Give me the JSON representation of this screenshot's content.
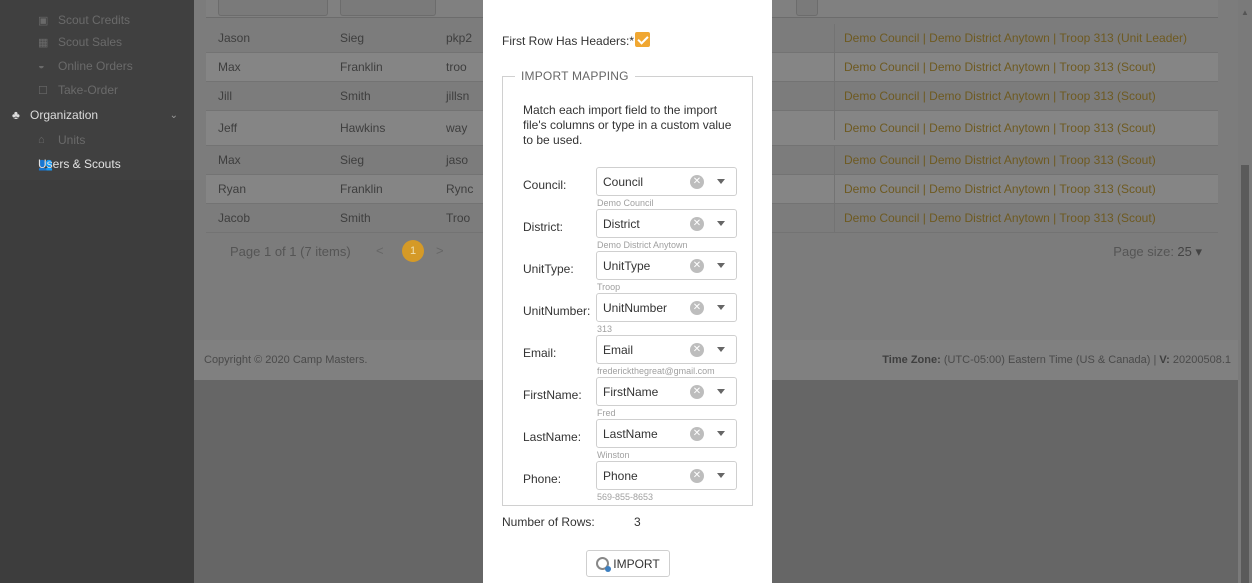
{
  "sidebar": {
    "items": [
      {
        "label": "Scout Credits",
        "icon": "credit-icon",
        "glyph": "▣"
      },
      {
        "label": "Scout Sales",
        "icon": "sales-icon",
        "glyph": "▦"
      },
      {
        "label": "Online Orders",
        "icon": "orders-icon",
        "glyph": "◒"
      },
      {
        "label": "Take-Order",
        "icon": "take-order-icon",
        "glyph": "☐"
      },
      {
        "label": "Organization",
        "icon": "sitemap-icon",
        "glyph": "♣",
        "chevron": "⌄"
      },
      {
        "label": "Units",
        "icon": "home-icon",
        "glyph": "⌂"
      },
      {
        "label": "Users & Scouts",
        "icon": "users-icon",
        "glyph": "👥"
      }
    ]
  },
  "table": {
    "rows": [
      {
        "first": "Jason",
        "last": "Sieg",
        "user": "pkp2",
        "org": "Demo Council | Demo District Anytown | Troop 313 (Unit Leader)"
      },
      {
        "first": "Max",
        "last": "Franklin",
        "user": "troo",
        "org": "Demo Council | Demo District Anytown | Troop 313 (Scout)"
      },
      {
        "first": "Jill",
        "last": "Smith",
        "user": "jillsn",
        "org": "Demo Council | Demo District Anytown | Troop 313 (Scout)"
      },
      {
        "first": "Jeff",
        "last": "Hawkins",
        "user": "way",
        "org": "Demo Council | Demo District Anytown | Troop 313 (Scout)"
      },
      {
        "first": "Max",
        "last": "Sieg",
        "user": "jaso",
        "org": "Demo Council | Demo District Anytown | Troop 313 (Scout)"
      },
      {
        "first": "Ryan",
        "last": "Franklin",
        "user": "Rync",
        "org": "Demo Council | Demo District Anytown | Troop 313 (Scout)"
      },
      {
        "first": "Jacob",
        "last": "Smith",
        "user": "Troo",
        "org": "Demo Council | Demo District Anytown | Troop 313 (Scout)"
      }
    ],
    "pager": {
      "summary": "Page 1 of 1 (7 items)",
      "prev": "<",
      "current": "1",
      "next": ">",
      "page_size_label": "Page size:",
      "page_size_value": "25 ▾"
    }
  },
  "footer": {
    "copyright": "Copyright © 2020 Camp Masters.",
    "tz_label": "Time Zone:",
    "tz_value": " (UTC-05:00) Eastern Time (US & Canada) | ",
    "version_label": "V:",
    "version_value": " 20200508.1"
  },
  "modal": {
    "first_row_label": "First Row Has Headers:*",
    "first_row_checked": true,
    "mapping_legend": "IMPORT MAPPING",
    "mapping_desc": "Match each import field to the import file's columns or type in a custom value to be used.",
    "fields": [
      {
        "label": "Council:",
        "value": "Council",
        "preview": "Demo Council"
      },
      {
        "label": "District:",
        "value": "District",
        "preview": "Demo District Anytown"
      },
      {
        "label": "UnitType:",
        "value": "UnitType",
        "preview": "Troop"
      },
      {
        "label": "UnitNumber:",
        "value": "UnitNumber",
        "preview": "313"
      },
      {
        "label": "Email:",
        "value": "Email",
        "preview": "frederickthegreat@gmail.com"
      },
      {
        "label": "FirstName:",
        "value": "FirstName",
        "preview": "Fred"
      },
      {
        "label": "LastName:",
        "value": "LastName",
        "preview": "Winston"
      },
      {
        "label": "Phone:",
        "value": "Phone",
        "preview": "569-855-8653"
      }
    ],
    "rows_label": "Number of Rows:",
    "rows_value": "3",
    "import_label": "IMPORT"
  },
  "colors": {
    "accent": "#f0a732",
    "overlay": "#666666"
  }
}
